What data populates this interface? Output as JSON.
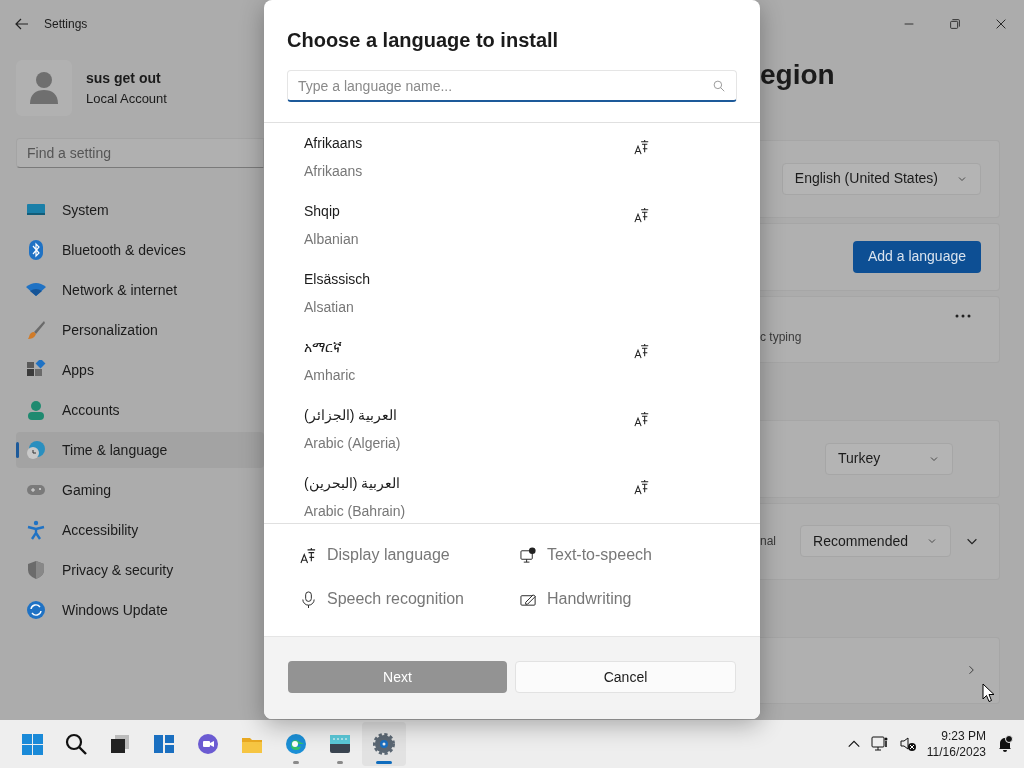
{
  "window": {
    "title": "Settings"
  },
  "account": {
    "name": "sus get out",
    "type": "Local Account"
  },
  "search": {
    "placeholder": "Find a setting"
  },
  "nav": [
    {
      "label": "System",
      "selected": false
    },
    {
      "label": "Bluetooth & devices",
      "selected": false
    },
    {
      "label": "Network & internet",
      "selected": false
    },
    {
      "label": "Personalization",
      "selected": false
    },
    {
      "label": "Apps",
      "selected": false
    },
    {
      "label": "Accounts",
      "selected": false
    },
    {
      "label": "Time & language",
      "selected": true
    },
    {
      "label": "Gaming",
      "selected": false
    },
    {
      "label": "Accessibility",
      "selected": false
    },
    {
      "label": "Privacy & security",
      "selected": false
    },
    {
      "label": "Windows Update",
      "selected": false
    }
  ],
  "page": {
    "title": "egion",
    "sections": [
      {
        "cards": [
          {
            "kind": "dropdown",
            "value": "English (United States)"
          },
          {
            "kind": "button",
            "label": "Add a language"
          },
          {
            "kind": "more",
            "description": "c typing"
          }
        ]
      },
      {
        "cards": [
          {
            "kind": "dropdown",
            "value": "Turkey"
          },
          {
            "kind": "dropdown",
            "description": "nal",
            "value": "Recommended",
            "expandable": true
          }
        ]
      },
      {
        "cards": [
          {
            "kind": "link"
          }
        ]
      }
    ]
  },
  "dialog": {
    "title": "Choose a language to install",
    "search_placeholder": "Type a language name...",
    "languages": [
      {
        "native": "Afrikaans",
        "english": "Afrikaans",
        "display_language": true
      },
      {
        "native": "Shqip",
        "english": "Albanian",
        "display_language": true
      },
      {
        "native": "Elsässisch",
        "english": "Alsatian",
        "display_language": false
      },
      {
        "native": "አማርኛ",
        "english": "Amharic",
        "display_language": true
      },
      {
        "native": "العربية (الجزائر)",
        "english": "Arabic (Algeria)",
        "display_language": true
      },
      {
        "native": "العربية (البحرين)",
        "english": "Arabic (Bahrain)",
        "display_language": true
      }
    ],
    "features": [
      {
        "kind": "display",
        "label": "Display language"
      },
      {
        "kind": "tts",
        "label": "Text-to-speech"
      },
      {
        "kind": "speech",
        "label": "Speech recognition"
      },
      {
        "kind": "handwriting",
        "label": "Handwriting"
      }
    ],
    "buttons": [
      {
        "label": "Next",
        "disabled": true
      },
      {
        "label": "Cancel",
        "disabled": false
      }
    ]
  },
  "taskbar": {
    "apps": [
      {
        "kind": "start",
        "running": false,
        "selected": false
      },
      {
        "kind": "search",
        "running": false,
        "selected": false
      },
      {
        "kind": "taskview",
        "running": false,
        "selected": false
      },
      {
        "kind": "widgets",
        "running": false,
        "selected": false
      },
      {
        "kind": "chat",
        "running": false,
        "selected": false
      },
      {
        "kind": "explorer",
        "running": false,
        "selected": false
      },
      {
        "kind": "edge",
        "running": true,
        "selected": false
      },
      {
        "kind": "terminal",
        "running": true,
        "selected": false
      },
      {
        "kind": "settings",
        "running": true,
        "selected": true
      }
    ],
    "time": "9:23 PM",
    "date": "11/16/2023"
  }
}
